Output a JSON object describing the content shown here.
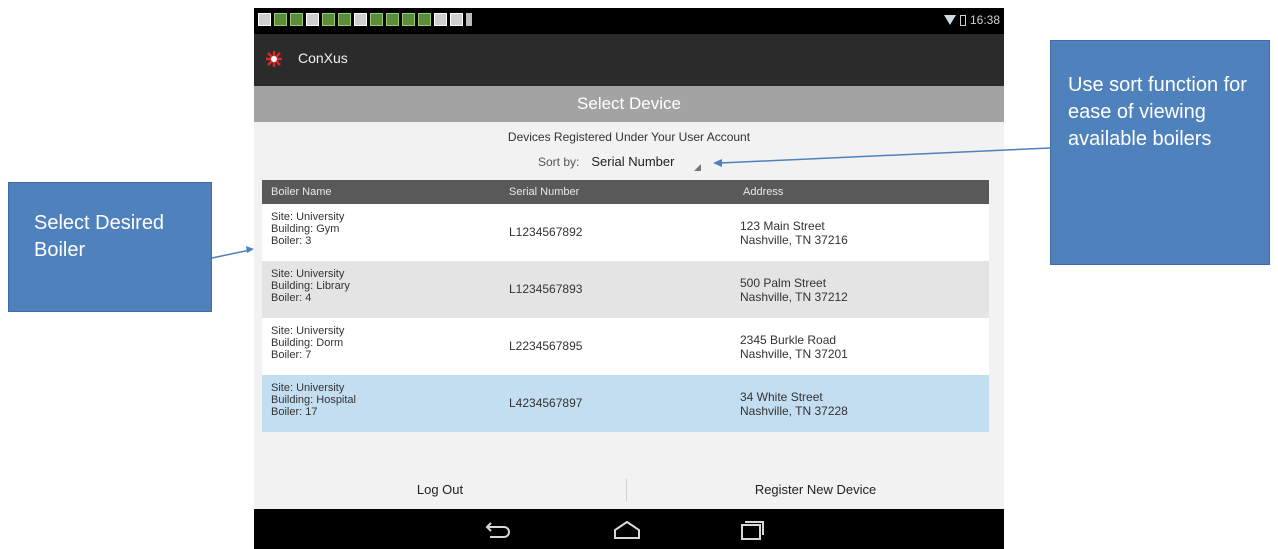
{
  "status_bar": {
    "time": "16:38"
  },
  "app": {
    "title": "ConXus"
  },
  "screen": {
    "title": "Select Device",
    "subtitle": "Devices Registered Under Your User Account",
    "sort_label": "Sort by:",
    "sort_value": "Serial Number"
  },
  "table": {
    "columns": [
      "Boiler Name",
      "Serial Number",
      "Address"
    ],
    "rows": [
      {
        "site": "Site: University",
        "building": "Building: Gym",
        "boiler": "Boiler: 3",
        "serial": "L1234567892",
        "address1": "123 Main Street",
        "address2": "Nashville, TN 37216"
      },
      {
        "site": "Site: University",
        "building": "Building: Library",
        "boiler": "Boiler: 4",
        "serial": "L1234567893",
        "address1": "500 Palm Street",
        "address2": "Nashville, TN 37212"
      },
      {
        "site": "Site: University",
        "building": "Building: Dorm",
        "boiler": "Boiler: 7",
        "serial": "L2234567895",
        "address1": "2345 Burkle Road",
        "address2": "Nashville, TN 37201"
      },
      {
        "site": "Site: University",
        "building": "Building: Hospital",
        "boiler": "Boiler: 17",
        "serial": "L4234567897",
        "address1": "34 White Street",
        "address2": "Nashville, TN 37228"
      }
    ]
  },
  "buttons": {
    "logout": "Log Out",
    "register": "Register New Device"
  },
  "annotations": {
    "left": "Select Desired Boiler",
    "right": "Use sort function for ease of viewing available boilers"
  },
  "colors": {
    "callout": "#4f81bd",
    "selected_row": "#c4def1",
    "header": "#595959"
  },
  "icons": [
    "wifi-icon",
    "battery-icon",
    "app-logo-icon",
    "back-icon",
    "home-icon",
    "recents-icon"
  ]
}
